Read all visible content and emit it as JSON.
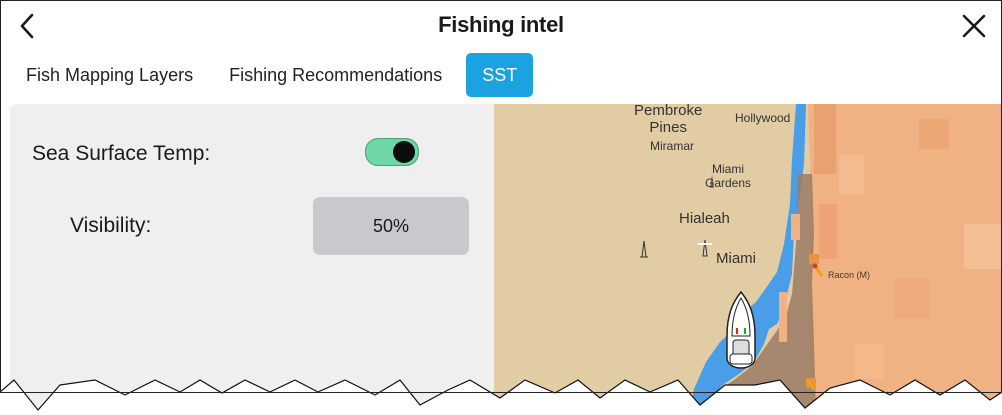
{
  "header": {
    "title": "Fishing intel",
    "back_icon": "chevron-left-icon",
    "close_icon": "close-icon"
  },
  "tabs": [
    {
      "label": "Fish Mapping Layers",
      "active": false
    },
    {
      "label": "Fishing Recommendations",
      "active": false
    },
    {
      "label": "SST",
      "active": true
    }
  ],
  "settings": {
    "sst_label": "Sea Surface Temp:",
    "sst_enabled": true,
    "visibility_label": "Visibility:",
    "visibility_value": "50%"
  },
  "map": {
    "places": {
      "pembroke_pines": "Pembroke\nPines",
      "hollywood": "Hollywood",
      "miramar": "Miramar",
      "miami_gardens": "Miami\nGardens",
      "hialeah": "Hialeah",
      "miami": "Miami",
      "racon": "Racon (M)"
    },
    "icons": [
      "lighthouse-icon",
      "boat-icon",
      "buoy-icon"
    ]
  },
  "colors": {
    "accent": "#1aa3e0",
    "toggle_on": "#6fd6a6",
    "land": "#e2cca3",
    "water_near": "#4a9ee8",
    "sst_warm": "#f0b283"
  }
}
